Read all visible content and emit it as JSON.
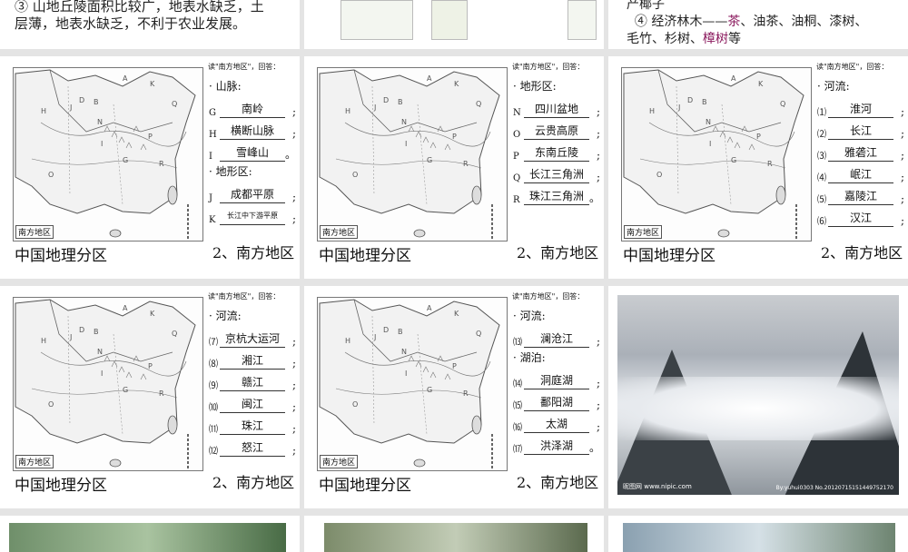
{
  "top_row": {
    "left_line1": "③ 山地丘陵面积比较广，地表水缺乏，土",
    "left_line2": "层薄，地表水缺乏，不利于农业发展。",
    "right_line1": "产椰子",
    "right_line2_a": "④ 经济林木——",
    "right_line2_b": "茶",
    "right_line2_c": "、油茶、油桐、漆树、",
    "right_line3_a": "毛竹、杉树、",
    "right_line3_b": "樟树",
    "right_line3_c": "等"
  },
  "common": {
    "map_label": "南方地区",
    "caption_left": "中国地理分区",
    "caption_right": "2、南方地区",
    "question_head": "读\"南方地区\"，回答："
  },
  "slides": [
    {
      "sections": [
        {
          "title": "· 山脉:",
          "rows": [
            {
              "key": "G",
              "value": "南岭",
              "end": ";"
            },
            {
              "key": "H",
              "value": "横断山脉",
              "end": ";"
            },
            {
              "key": "I",
              "value": "雪峰山",
              "end": "。"
            }
          ]
        },
        {
          "title": "· 地形区:",
          "rows": [
            {
              "key": "J",
              "value": "成都平原",
              "end": ";"
            },
            {
              "key": "K",
              "value": "长江中下游平原",
              "end": ";",
              "small": true
            }
          ]
        }
      ]
    },
    {
      "sections": [
        {
          "title": "· 地形区:",
          "rows": [
            {
              "key": "N",
              "value": "四川盆地",
              "end": ";"
            },
            {
              "key": "O",
              "value": "云贵高原",
              "end": ";"
            },
            {
              "key": "P",
              "value": "东南丘陵",
              "end": ";"
            },
            {
              "key": "Q",
              "value": "长江三角洲",
              "end": ";"
            },
            {
              "key": "R",
              "value": "珠江三角洲",
              "end": "。"
            }
          ]
        }
      ]
    },
    {
      "sections": [
        {
          "title": "· 河流:",
          "rows": [
            {
              "key": "⑴",
              "value": "淮河",
              "end": ";"
            },
            {
              "key": "⑵",
              "value": "长江",
              "end": ";"
            },
            {
              "key": "⑶",
              "value": "雅砻江",
              "end": ";"
            },
            {
              "key": "⑷",
              "value": "岷江",
              "end": ";"
            },
            {
              "key": "⑸",
              "value": "嘉陵江",
              "end": ";"
            },
            {
              "key": "⑹",
              "value": "汉江",
              "end": ";"
            }
          ]
        }
      ]
    },
    {
      "sections": [
        {
          "title": "· 河流:",
          "rows": [
            {
              "key": "⑺",
              "value": "京杭大运河",
              "end": ";"
            },
            {
              "key": "⑻",
              "value": "湘江",
              "end": ";"
            },
            {
              "key": "⑼",
              "value": "赣江",
              "end": ";"
            },
            {
              "key": "⑽",
              "value": "闽江",
              "end": ";"
            },
            {
              "key": "⑾",
              "value": "珠江",
              "end": ";"
            },
            {
              "key": "⑿",
              "value": "怒江",
              "end": ";"
            }
          ]
        }
      ]
    },
    {
      "sections": [
        {
          "title": "· 河流:",
          "rows": [
            {
              "key": "⒀",
              "value": "澜沧江",
              "end": ";"
            }
          ]
        },
        {
          "title": "· 湖泊:",
          "rows": [
            {
              "key": "⒁",
              "value": "洞庭湖",
              "end": ";"
            },
            {
              "key": "⒂",
              "value": "鄱阳湖",
              "end": ";"
            },
            {
              "key": "⒃",
              "value": "太湖",
              "end": ";"
            },
            {
              "key": "⒄",
              "value": "洪泽湖",
              "end": "。"
            }
          ]
        }
      ]
    }
  ],
  "photo": {
    "watermark_left": "昵图网 www.nipic.com",
    "watermark_right": "By:yuhui0303 No.20120715151449752170"
  },
  "colors": {
    "highlight": "#8b1a5e",
    "background": "#e4e4e4"
  }
}
